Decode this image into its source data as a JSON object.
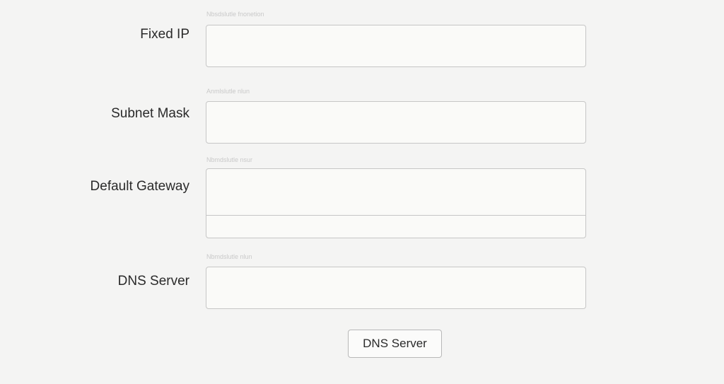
{
  "form": {
    "fields": [
      {
        "label": "Fixed IP",
        "hint": "Nbsdslutle fnonetion"
      },
      {
        "label": "Subnet Mask",
        "hint": "Anmlslutle nlun"
      },
      {
        "label": "Default Gateway",
        "hint": "Nbmdslutle nsur"
      },
      {
        "label": "DNS Server",
        "hint": "Nbmdslutle nlun"
      }
    ],
    "submit_label": "DNS Server"
  }
}
